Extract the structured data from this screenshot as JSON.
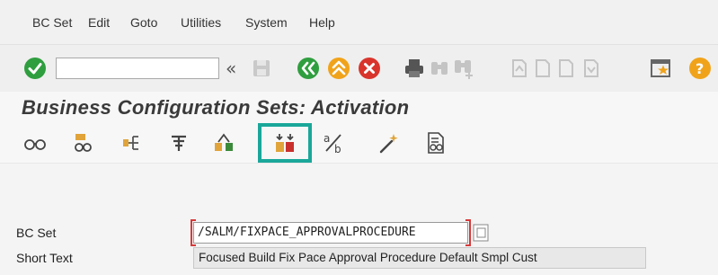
{
  "menu": {
    "items": [
      "BC Set",
      "Edit",
      "Goto",
      "Utilities",
      "System",
      "Help"
    ]
  },
  "toolbar": {
    "command_value": "",
    "icons": [
      "enter-icon",
      "back-arrows-icon",
      "save-icon",
      "back-icon",
      "exit-icon",
      "cancel-icon",
      "print-icon",
      "find-icon",
      "find-next-icon",
      "first-page-icon",
      "previous-page-icon",
      "next-page-icon",
      "last-page-icon",
      "new-session-icon",
      "help-icon"
    ]
  },
  "title": "Business Configuration Sets: Activation",
  "app_toolbar": {
    "icons": [
      "display-icon",
      "hierarchy-icon",
      "tree-icon",
      "transport-icon",
      "compare-icon",
      "activate-icon",
      "percent-icon",
      "wizard-icon",
      "documentation-icon"
    ],
    "highlighted": "activate-icon"
  },
  "form": {
    "bc_set_label": "BC Set",
    "bc_set_value": "/SALM/FIXPACE_APPROVALPROCEDURE",
    "short_text_label": "Short Text",
    "short_text_value": "Focused Build Fix Pace Approval Procedure Default Smpl Cust"
  },
  "colors": {
    "enter_green": "#2f9e3f",
    "back_green": "#2f9e3f",
    "exit_orange": "#f0a31a",
    "cancel_red": "#d9342b",
    "help_orange": "#f0a31a",
    "highlight": "#1aa79a",
    "required_red": "#d63a3a"
  }
}
